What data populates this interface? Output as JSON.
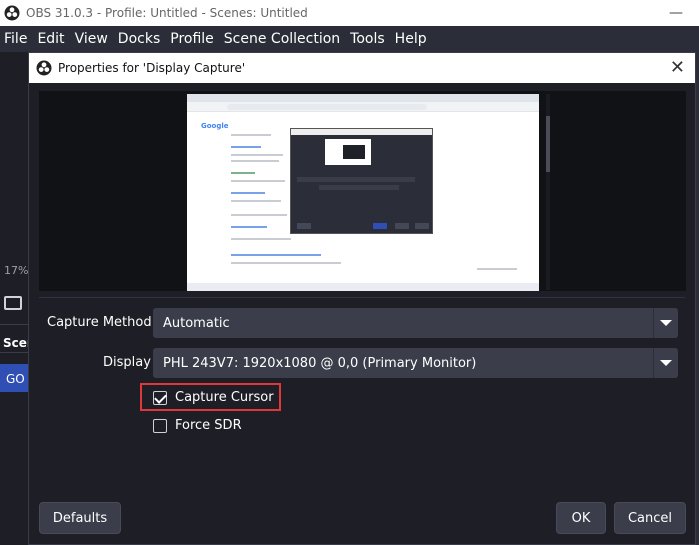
{
  "app": {
    "window_title": "OBS 31.0.3 - Profile: Untitled - Scenes: Untitled",
    "minimize_glyph": "—"
  },
  "menu": {
    "items": [
      "File",
      "Edit",
      "View",
      "Docks",
      "Profile",
      "Scene Collection",
      "Tools",
      "Help"
    ]
  },
  "left_panel": {
    "zoom_percent": "17%",
    "scenes_label": "Scen",
    "go_label": "GO"
  },
  "dialog": {
    "title": "Properties for 'Display Capture'",
    "close_glyph": "✕",
    "fields": {
      "capture_method": {
        "label": "Capture Method",
        "value": "Automatic"
      },
      "display": {
        "label": "Display",
        "value": "PHL 243V7: 1920x1080 @ 0,0 (Primary Monitor)"
      }
    },
    "checkboxes": {
      "capture_cursor": {
        "label": "Capture Cursor",
        "checked": true
      },
      "force_sdr": {
        "label": "Force SDR",
        "checked": false
      }
    },
    "buttons": {
      "defaults": "Defaults",
      "ok": "OK",
      "cancel": "Cancel"
    }
  },
  "colors": {
    "background": "#1e1f26",
    "control": "#3b3e4a",
    "accent_highlight": "#e0383a",
    "accent_blue": "#2f4fb5"
  }
}
